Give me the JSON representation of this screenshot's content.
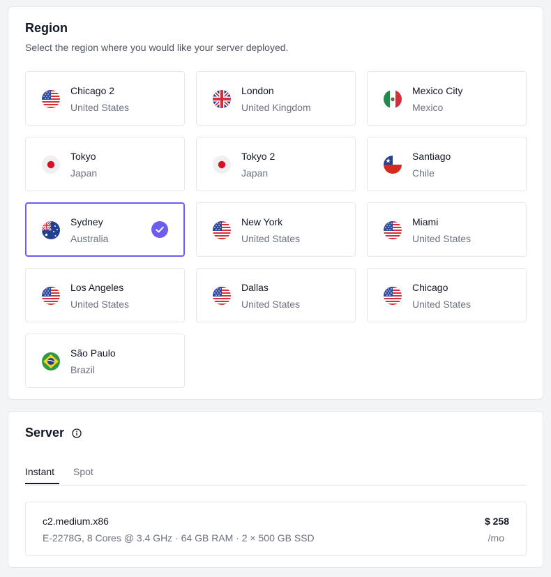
{
  "region": {
    "title": "Region",
    "subtitle": "Select the region where you would like your server deployed.",
    "tiles": [
      {
        "city": "Chicago 2",
        "country": "United States",
        "flag": "us-flag-icon",
        "selected": false
      },
      {
        "city": "London",
        "country": "United Kingdom",
        "flag": "uk-flag-icon",
        "selected": false
      },
      {
        "city": "Mexico City",
        "country": "Mexico",
        "flag": "mexico-flag-icon",
        "selected": false
      },
      {
        "city": "Tokyo",
        "country": "Japan",
        "flag": "japan-flag-icon",
        "selected": false
      },
      {
        "city": "Tokyo 2",
        "country": "Japan",
        "flag": "japan-flag-icon",
        "selected": false
      },
      {
        "city": "Santiago",
        "country": "Chile",
        "flag": "chile-flag-icon",
        "selected": false
      },
      {
        "city": "Sydney",
        "country": "Australia",
        "flag": "australia-flag-icon",
        "selected": true
      },
      {
        "city": "New York",
        "country": "United States",
        "flag": "us-flag-icon",
        "selected": false
      },
      {
        "city": "Miami",
        "country": "United States",
        "flag": "us-flag-icon",
        "selected": false
      },
      {
        "city": "Los Angeles",
        "country": "United States",
        "flag": "us-flag-icon",
        "selected": false
      },
      {
        "city": "Dallas",
        "country": "United States",
        "flag": "us-flag-icon",
        "selected": false
      },
      {
        "city": "Chicago",
        "country": "United States",
        "flag": "us-flag-icon",
        "selected": false
      },
      {
        "city": "São Paulo",
        "country": "Brazil",
        "flag": "brazil-flag-icon",
        "selected": false
      }
    ]
  },
  "server": {
    "title": "Server",
    "info_icon": "info-icon",
    "tabs": [
      {
        "label": "Instant",
        "active": true
      },
      {
        "label": "Spot",
        "active": false
      }
    ],
    "plan": {
      "name": "c2.medium.x86",
      "specs": "E-2278G, 8 Cores @ 3.4 GHz · 64 GB RAM · 2 × 500 GB SSD",
      "price": "$ 258",
      "period": "/mo"
    }
  },
  "colors": {
    "accent": "#6d5cf0",
    "border": "#e5e7eb",
    "background": "#f3f4f6",
    "text_primary": "#111827",
    "text_secondary": "#6b7280"
  }
}
